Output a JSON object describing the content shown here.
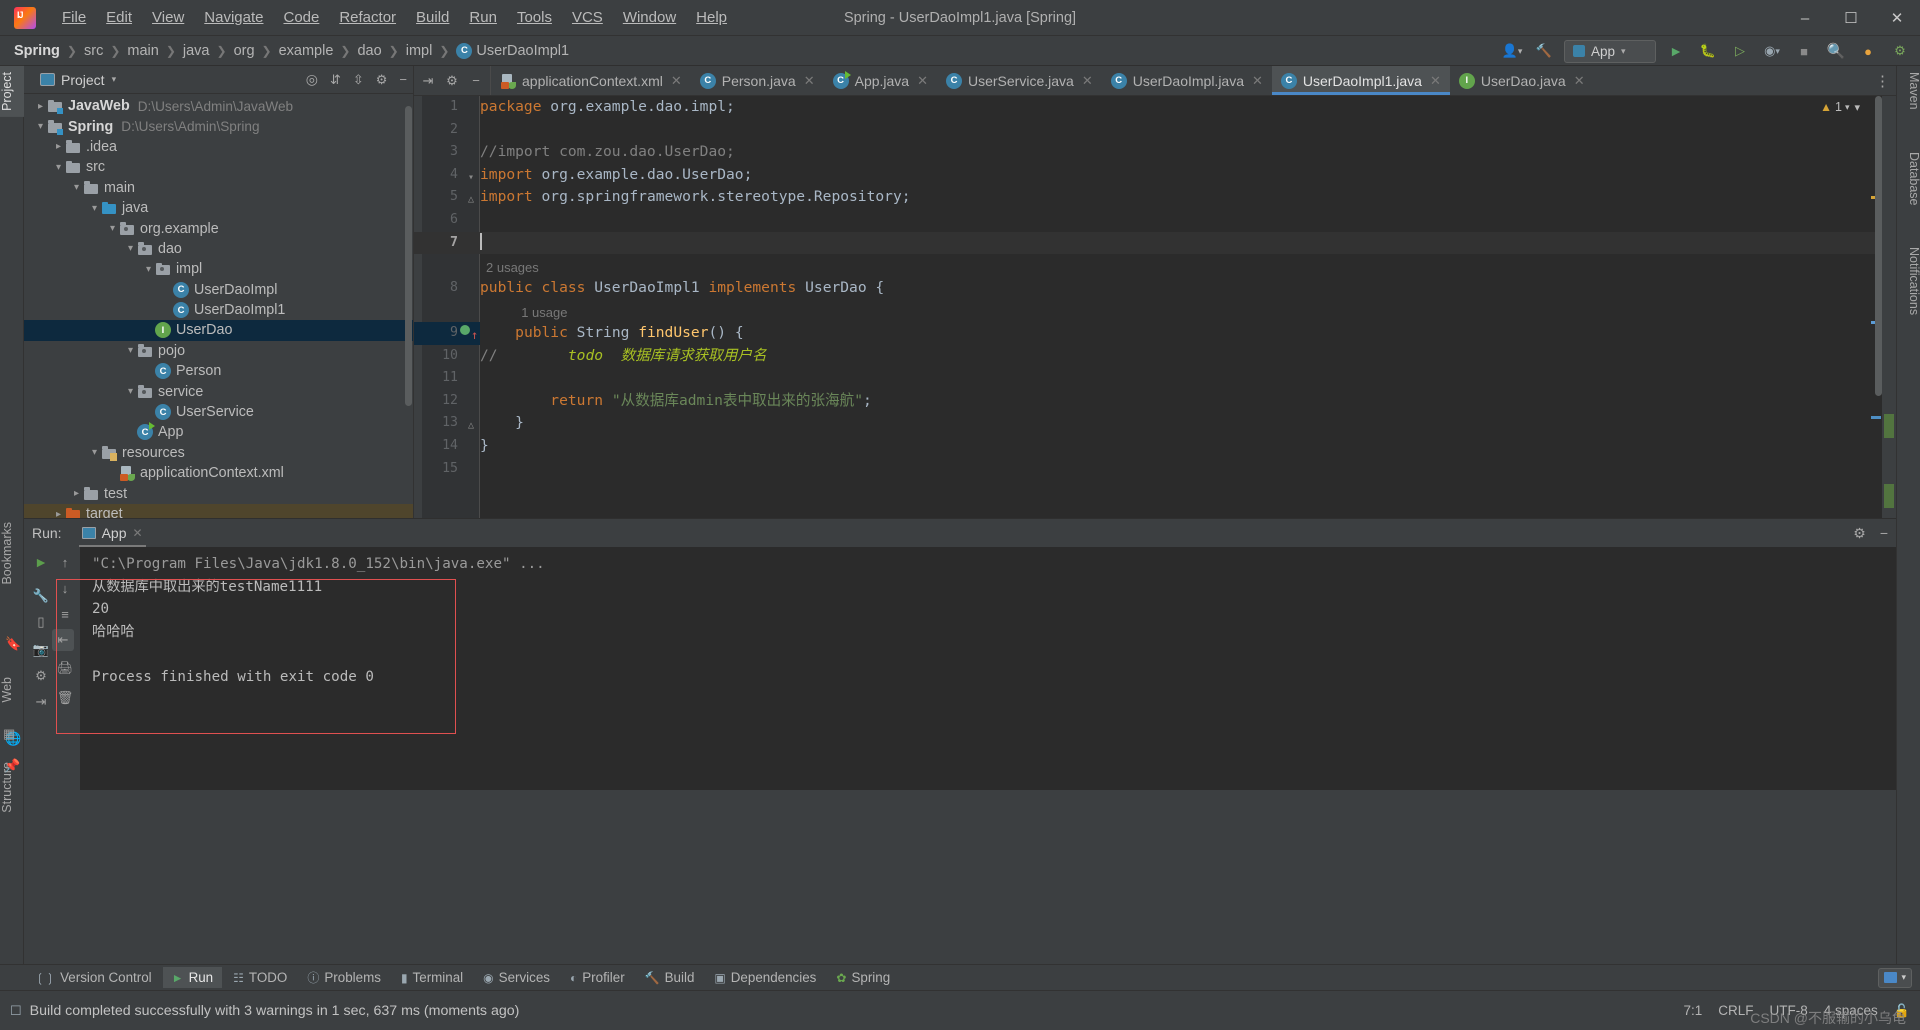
{
  "window": {
    "title": "Spring - UserDaoImpl1.java [Spring]",
    "logo_icon": "intellij-idea-logo",
    "minimize_label": "–",
    "maximize_label": "❐",
    "close_label": "✕"
  },
  "menubar": [
    {
      "label": "File"
    },
    {
      "label": "Edit"
    },
    {
      "label": "View"
    },
    {
      "label": "Navigate"
    },
    {
      "label": "Code"
    },
    {
      "label": "Refactor"
    },
    {
      "label": "Build"
    },
    {
      "label": "Run"
    },
    {
      "label": "Tools"
    },
    {
      "label": "VCS"
    },
    {
      "label": "Window"
    },
    {
      "label": "Help"
    }
  ],
  "breadcrumb": [
    {
      "label": "Spring",
      "bold": true
    },
    {
      "label": "src",
      "bold": false
    },
    {
      "label": "main",
      "bold": false
    },
    {
      "label": "java",
      "bold": false
    },
    {
      "label": "org",
      "bold": false
    },
    {
      "label": "example",
      "bold": false
    },
    {
      "label": "dao",
      "bold": false
    },
    {
      "label": "impl",
      "bold": false
    },
    {
      "label": "UserDaoImpl1",
      "bold": false,
      "icon": "class-icon"
    }
  ],
  "navbar_right": {
    "user_icon": "user-avatar-icon",
    "hammer_icon": "build-hammer-icon",
    "run_config_label": "App",
    "run_config_icon": "app-run-config-icon",
    "run_icon": "run-play-icon",
    "debug_icon": "debug-bug-icon",
    "run_coverage_icon": "run-with-coverage-icon",
    "profiler_icon": "profiler-icon",
    "stop_icon": "stop-icon",
    "search_icon": "search-everywhere-icon",
    "updates_icon": "updates-icon",
    "gear_icon": "settings-gear-icon"
  },
  "left_strip": {
    "project_tab": "Project",
    "bookmarks_tab": "Bookmarks",
    "web_tab": "Web",
    "structure_tab": "Structure",
    "bookmark_icon": "bookmark-icon",
    "pin_icon": "pin-icon",
    "grid_icon": "structure-grid-icon"
  },
  "right_strip": {
    "maven_tab": "Maven",
    "database_tab": "Database",
    "notifications_tab": "Notifications"
  },
  "project_panel": {
    "title": "Project",
    "title_icon": "project-folder-icon",
    "dropdown_icon": "chevron-down-icon",
    "locate_icon": "select-opened-file-icon",
    "expand_icon": "expand-all-icon",
    "collapse_icon": "collapse-all-icon",
    "settings_icon": "gear-icon",
    "hide_icon": "hide-panel-icon",
    "tree": [
      {
        "indent": 0,
        "arrow": "right",
        "icon": "module-folder-icon",
        "label": "JavaWeb",
        "bold": true,
        "path": "D:\\Users\\Admin\\JavaWeb",
        "state": "normal"
      },
      {
        "indent": 0,
        "arrow": "down",
        "icon": "module-folder-icon",
        "label": "Spring",
        "bold": true,
        "path": "D:\\Users\\Admin\\Spring",
        "state": "normal"
      },
      {
        "indent": 1,
        "arrow": "right",
        "icon": "folder-icon",
        "label": ".idea",
        "bold": false,
        "path": "",
        "state": "normal"
      },
      {
        "indent": 1,
        "arrow": "down",
        "icon": "folder-icon",
        "label": "src",
        "bold": false,
        "path": "",
        "state": "normal"
      },
      {
        "indent": 2,
        "arrow": "down",
        "icon": "folder-icon",
        "label": "main",
        "bold": false,
        "path": "",
        "state": "normal"
      },
      {
        "indent": 3,
        "arrow": "down",
        "icon": "source-folder-icon",
        "label": "java",
        "bold": false,
        "path": "",
        "state": "normal"
      },
      {
        "indent": 4,
        "arrow": "down",
        "icon": "package-icon",
        "label": "org.example",
        "bold": false,
        "path": "",
        "state": "normal"
      },
      {
        "indent": 5,
        "arrow": "down",
        "icon": "package-icon",
        "label": "dao",
        "bold": false,
        "path": "",
        "state": "normal"
      },
      {
        "indent": 6,
        "arrow": "down",
        "icon": "package-icon",
        "label": "impl",
        "bold": false,
        "path": "",
        "state": "normal"
      },
      {
        "indent": 7,
        "arrow": "none",
        "icon": "class-icon",
        "label": "UserDaoImpl",
        "bold": false,
        "path": "",
        "state": "normal"
      },
      {
        "indent": 7,
        "arrow": "none",
        "icon": "class-icon",
        "label": "UserDaoImpl1",
        "bold": false,
        "path": "",
        "state": "normal"
      },
      {
        "indent": 6,
        "arrow": "none",
        "icon": "interface-icon",
        "label": "UserDao",
        "bold": false,
        "path": "",
        "state": "selected"
      },
      {
        "indent": 5,
        "arrow": "down",
        "icon": "package-icon",
        "label": "pojo",
        "bold": false,
        "path": "",
        "state": "normal"
      },
      {
        "indent": 6,
        "arrow": "none",
        "icon": "class-icon",
        "label": "Person",
        "bold": false,
        "path": "",
        "state": "normal"
      },
      {
        "indent": 5,
        "arrow": "down",
        "icon": "package-icon",
        "label": "service",
        "bold": false,
        "path": "",
        "state": "normal"
      },
      {
        "indent": 6,
        "arrow": "none",
        "icon": "class-icon",
        "label": "UserService",
        "bold": false,
        "path": "",
        "state": "normal"
      },
      {
        "indent": 5,
        "arrow": "none",
        "icon": "runnable-class-icon",
        "label": "App",
        "bold": false,
        "path": "",
        "state": "normal"
      },
      {
        "indent": 3,
        "arrow": "down",
        "icon": "resources-folder-icon",
        "label": "resources",
        "bold": false,
        "path": "",
        "state": "normal"
      },
      {
        "indent": 4,
        "arrow": "none",
        "icon": "spring-xml-icon",
        "label": "applicationContext.xml",
        "bold": false,
        "path": "",
        "state": "normal"
      },
      {
        "indent": 2,
        "arrow": "right",
        "icon": "folder-icon",
        "label": "test",
        "bold": false,
        "path": "",
        "state": "normal"
      },
      {
        "indent": 1,
        "arrow": "right",
        "icon": "excluded-folder-icon",
        "label": "target",
        "bold": false,
        "path": "",
        "state": "highlight"
      }
    ]
  },
  "editor": {
    "tab_tools": {
      "collapse_icon": "collapse-all-icon",
      "gear_icon": "settings-gear-icon",
      "hide_icon": "hide-panel-icon",
      "more_icon": "more-tabs-icon"
    },
    "tabs": [
      {
        "label": "applicationContext.xml",
        "icon": "spring-xml-icon",
        "active": false
      },
      {
        "label": "Person.java",
        "icon": "class-icon",
        "active": false
      },
      {
        "label": "App.java",
        "icon": "runnable-class-icon",
        "active": false
      },
      {
        "label": "UserService.java",
        "icon": "class-icon",
        "active": false
      },
      {
        "label": "UserDaoImpl.java",
        "icon": "class-icon",
        "active": false
      },
      {
        "label": "UserDaoImpl1.java",
        "icon": "class-icon",
        "active": true
      },
      {
        "label": "UserDao.java",
        "icon": "interface-icon",
        "active": false
      }
    ],
    "close_icon": "close-tab-icon",
    "warning_count": "1",
    "warning_icon": "warning-triangle-icon",
    "inspection_chevron": "chevron-down-icon",
    "lines": [
      {
        "num": "1",
        "tokens": [
          {
            "t": "package",
            "c": "kw"
          },
          {
            "t": " org.example.dao.impl;",
            "c": "plain"
          }
        ]
      },
      {
        "num": "2",
        "tokens": []
      },
      {
        "num": "3",
        "tokens": [
          {
            "t": "//import com.zou.dao.UserDao;",
            "c": "cmt"
          }
        ]
      },
      {
        "num": "4",
        "tokens": [
          {
            "t": "import",
            "c": "kw"
          },
          {
            "t": " org.example.dao.UserDao;",
            "c": "plain"
          }
        ],
        "fold": "collapse"
      },
      {
        "num": "5",
        "tokens": [
          {
            "t": "import",
            "c": "kw"
          },
          {
            "t": " org.springframework.stereotype.Repository;",
            "c": "plain"
          }
        ],
        "fold": "end"
      },
      {
        "num": "6",
        "tokens": []
      },
      {
        "num": "7",
        "tokens": [],
        "caret": true,
        "current": true
      },
      {
        "num": "8",
        "tokens": [
          {
            "t": "public",
            "c": "kw"
          },
          {
            "t": " ",
            "c": "plain"
          },
          {
            "t": "class",
            "c": "kw"
          },
          {
            "t": " UserDaoImpl1 ",
            "c": "plain"
          },
          {
            "t": "implements",
            "c": "kw"
          },
          {
            "t": " UserDao {",
            "c": "plain"
          }
        ],
        "hint": "2 usages",
        "hint_indent": 0
      },
      {
        "num": "9",
        "tokens": [
          {
            "t": "    ",
            "c": "plain"
          },
          {
            "t": "public",
            "c": "kw"
          },
          {
            "t": " ",
            "c": "plain"
          },
          {
            "t": "String",
            "c": "cls"
          },
          {
            "t": " ",
            "c": "plain"
          },
          {
            "t": "findUser",
            "c": "mth"
          },
          {
            "t": "() {",
            "c": "plain"
          }
        ],
        "hint": "1 usage",
        "hint_indent": 4,
        "marker": "override-implements",
        "selected": true
      },
      {
        "num": "10",
        "tokens": [
          {
            "t": "//",
            "c": "cmt"
          },
          {
            "t": "        ",
            "c": "plain"
          },
          {
            "t": "todo",
            "c": "todo"
          },
          {
            "t": "  数据库请求获取用户名",
            "c": "todo"
          }
        ]
      },
      {
        "num": "11",
        "tokens": []
      },
      {
        "num": "12",
        "tokens": [
          {
            "t": "        ",
            "c": "plain"
          },
          {
            "t": "return",
            "c": "kw"
          },
          {
            "t": " ",
            "c": "plain"
          },
          {
            "t": "\"从数据库admin表中取出来的张海航\"",
            "c": "str"
          },
          {
            "t": ";",
            "c": "plain"
          }
        ]
      },
      {
        "num": "13",
        "tokens": [
          {
            "t": "    }",
            "c": "plain"
          }
        ],
        "fold": "end"
      },
      {
        "num": "14",
        "tokens": [
          {
            "t": "}",
            "c": "plain"
          }
        ]
      },
      {
        "num": "15",
        "tokens": []
      }
    ]
  },
  "run_panel": {
    "label": "Run:",
    "tab_label": "App",
    "tab_icon": "run-configuration-icon",
    "close_icon": "close-tab-icon",
    "gear_icon": "settings-gear-icon",
    "hide_icon": "hide-panel-icon",
    "gutter_icons": [
      {
        "name": "rerun-icon",
        "glyph": "▶",
        "color": "#5c9e4c",
        "selected": false
      },
      {
        "name": "scroll-up-icon",
        "glyph": "↑",
        "color": "#8a8a8a",
        "selected": false
      },
      {
        "name": "scroll-down-icon",
        "glyph": "↓",
        "color": "#8a8a8a",
        "selected": false
      },
      {
        "name": "stop-icon",
        "glyph": "■",
        "color": "#8a8a8a",
        "selected": false
      },
      {
        "name": "soft-wrap-icon",
        "glyph": "↵",
        "color": "#b0b0b0",
        "selected": false
      },
      {
        "name": "scroll-to-end-icon",
        "glyph": "⇥",
        "color": "#d0d0d0",
        "selected": true
      },
      {
        "name": "print-icon",
        "glyph": "⎙",
        "color": "#a0a0a0",
        "selected": false
      },
      {
        "name": "debug-icon",
        "glyph": "⚙",
        "color": "#a0a0a0",
        "selected": false
      },
      {
        "name": "export-icon",
        "glyph": "⤓",
        "color": "#a0a0a0",
        "selected": false
      },
      {
        "name": "trash-icon",
        "glyph": "Ὕ1",
        "color": "#a0a0a0",
        "selected": false
      }
    ],
    "console_lines": [
      {
        "text": "\"C:\\Program Files\\Java\\jdk1.8.0_152\\bin\\java.exe\" ...",
        "color": "#9a9a9a"
      },
      {
        "text": "从数据库中取出来的testName1111",
        "color": "#bbbbbb"
      },
      {
        "text": "20",
        "color": "#bbbbbb"
      },
      {
        "text": "哈哈哈",
        "color": "#bbbbbb"
      },
      {
        "text": "",
        "color": "#bbbbbb"
      },
      {
        "text": "Process finished with exit code 0",
        "color": "#bbbbbb"
      }
    ]
  },
  "bottom_bar": {
    "items": [
      {
        "label": "Version Control",
        "icon": "version-control-icon",
        "active": false
      },
      {
        "label": "Run",
        "icon": "run-play-icon",
        "active": true
      },
      {
        "label": "TODO",
        "icon": "todo-icon",
        "active": false
      },
      {
        "label": "Problems",
        "icon": "problems-icon",
        "active": false
      },
      {
        "label": "Terminal",
        "icon": "terminal-icon",
        "active": false
      },
      {
        "label": "Services",
        "icon": "services-icon",
        "active": false
      },
      {
        "label": "Profiler",
        "icon": "profiler-icon",
        "active": false
      },
      {
        "label": "Build",
        "icon": "build-hammer-icon",
        "active": false
      },
      {
        "label": "Dependencies",
        "icon": "dependencies-icon",
        "active": false
      },
      {
        "label": "Spring",
        "icon": "spring-leaf-icon",
        "active": false
      }
    ],
    "layout_icon": "layout-switch-icon",
    "layout_chevron": "chevron-down-icon"
  },
  "status_bar": {
    "build_icon": "build-status-icon",
    "message": "Build completed successfully with 3 warnings in 1 sec, 637 ms (moments ago)",
    "caret_position": "7:1",
    "line_separator": "CRLF",
    "encoding": "UTF-8",
    "indent": "4 spaces",
    "lock_icon": "read-only-lock-icon",
    "watermark": "CSDN @不服输的小乌龟"
  },
  "colors": {
    "accent": "#4a88c7",
    "keyword": "#cc7832",
    "string": "#6a8759",
    "comment": "#808080",
    "todo": "#a8c023",
    "method": "#ffc66d",
    "class_ref": "#a9b7c6",
    "selection": "#0d293e",
    "editor_bg": "#2b2b2b",
    "panel_bg": "#3c3f41"
  }
}
